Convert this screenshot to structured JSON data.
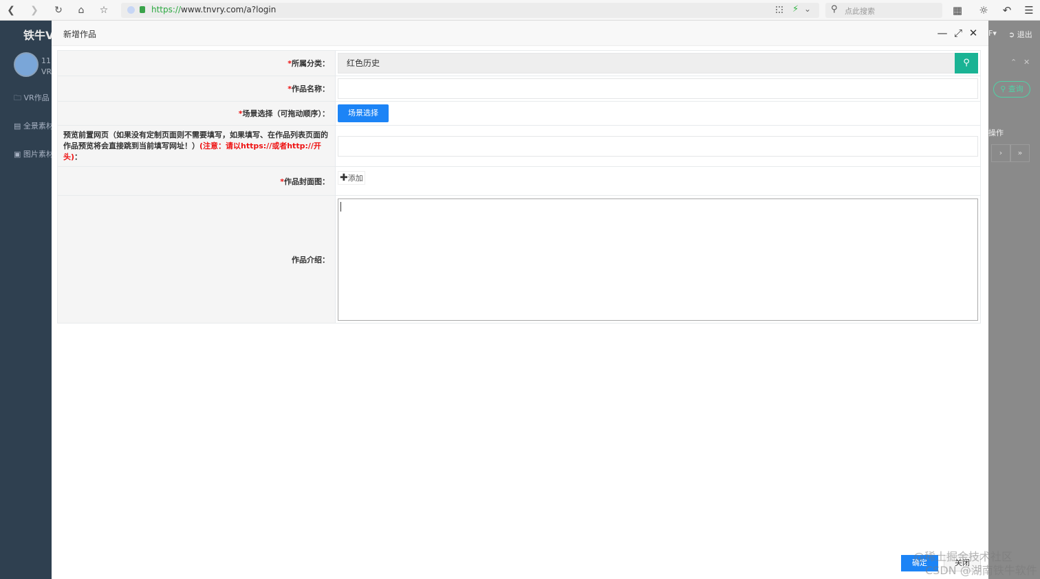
{
  "browser": {
    "url_scheme": "https://",
    "url_rest": "www.tnvry.com/a?login",
    "search_placeholder": "点此搜索"
  },
  "app": {
    "brand": "铁牛VR",
    "user_line1": "11",
    "user_line2": "VR",
    "menu": [
      "VR作品",
      "全景素材",
      "图片素材"
    ],
    "right_top_text": "F▾",
    "logout": "退出",
    "query_button": "查询",
    "op_header": "操作",
    "pager_next": "›",
    "pager_last": "»"
  },
  "modal": {
    "title": "新增作品",
    "fields": {
      "category_label": "所属分类：",
      "category_value": "红色历史",
      "name_label": "作品名称：",
      "scene_label": "场景选择（可拖动顺序）：",
      "scene_button": "场景选择",
      "preview_label": "预览前置网页（如果没有定制页面则不需要填写，如果填写、在作品列表页面的作品预览将会直接跳到当前填写网址！）",
      "preview_warning": "(注意：请以https://或者http://开头)",
      "preview_suffix": "：",
      "cover_label": "作品封面图：",
      "cover_add": "添加",
      "intro_label": "作品介绍："
    },
    "ok_button": "确定",
    "close_button": "关闭"
  },
  "watermarks": [
    "@稀土掘金技术社区",
    "CSDN @湖南铁牛软件"
  ],
  "colors": {
    "primary_blue": "#1c84f6",
    "search_green": "#1ab394",
    "required_red": "#ee1111",
    "sidebar_dark": "#2f4050"
  }
}
